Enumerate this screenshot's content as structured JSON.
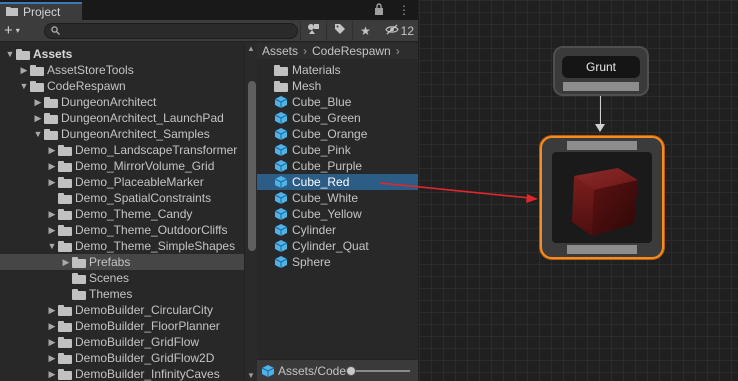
{
  "window": {
    "tab_title": "Project",
    "hidden_count": "12"
  },
  "toolbar": {
    "add_label": "+",
    "search_placeholder": ""
  },
  "tree": {
    "items": [
      {
        "label": "Assets",
        "depth": 0,
        "expanded": true,
        "bold": true
      },
      {
        "label": "AssetStoreTools",
        "depth": 1,
        "expanded": false
      },
      {
        "label": "CodeRespawn",
        "depth": 1,
        "expanded": true
      },
      {
        "label": "DungeonArchitect",
        "depth": 2,
        "expanded": false
      },
      {
        "label": "DungeonArchitect_LaunchPad",
        "depth": 2,
        "expanded": false
      },
      {
        "label": "DungeonArchitect_Samples",
        "depth": 2,
        "expanded": true
      },
      {
        "label": "Demo_LandscapeTransformer",
        "depth": 3,
        "expanded": false
      },
      {
        "label": "Demo_MirrorVolume_Grid",
        "depth": 3,
        "expanded": false
      },
      {
        "label": "Demo_PlaceableMarker",
        "depth": 3,
        "expanded": false
      },
      {
        "label": "Demo_SpatialConstraints",
        "depth": 3,
        "leaf": true
      },
      {
        "label": "Demo_Theme_Candy",
        "depth": 3,
        "expanded": false
      },
      {
        "label": "Demo_Theme_OutdoorCliffs",
        "depth": 3,
        "expanded": false
      },
      {
        "label": "Demo_Theme_SimpleShapes",
        "depth": 3,
        "expanded": true
      },
      {
        "label": "Prefabs",
        "depth": 4,
        "expanded": false,
        "selected": true
      },
      {
        "label": "Scenes",
        "depth": 4,
        "leaf": true
      },
      {
        "label": "Themes",
        "depth": 4,
        "leaf": true
      },
      {
        "label": "DemoBuilder_CircularCity",
        "depth": 3,
        "expanded": false
      },
      {
        "label": "DemoBuilder_FloorPlanner",
        "depth": 3,
        "expanded": false
      },
      {
        "label": "DemoBuilder_GridFlow",
        "depth": 3,
        "expanded": false
      },
      {
        "label": "DemoBuilder_GridFlow2D",
        "depth": 3,
        "expanded": false
      },
      {
        "label": "DemoBuilder_InfinityCaves",
        "depth": 3,
        "expanded": false
      }
    ]
  },
  "assets": {
    "breadcrumb": [
      "Assets",
      "CodeRespawn"
    ],
    "items": [
      {
        "label": "Materials",
        "kind": "folder"
      },
      {
        "label": "Mesh",
        "kind": "folder"
      },
      {
        "label": "Cube_Blue",
        "kind": "prefab"
      },
      {
        "label": "Cube_Green",
        "kind": "prefab"
      },
      {
        "label": "Cube_Orange",
        "kind": "prefab"
      },
      {
        "label": "Cube_Pink",
        "kind": "prefab"
      },
      {
        "label": "Cube_Purple",
        "kind": "prefab"
      },
      {
        "label": "Cube_Red",
        "kind": "prefab",
        "selected": true
      },
      {
        "label": "Cube_White",
        "kind": "prefab"
      },
      {
        "label": "Cube_Yellow",
        "kind": "prefab"
      },
      {
        "label": "Cylinder",
        "kind": "prefab"
      },
      {
        "label": "Cylinder_Quat",
        "kind": "prefab"
      },
      {
        "label": "Sphere",
        "kind": "prefab"
      }
    ],
    "status_path": "Assets/Code"
  },
  "graph": {
    "source_node_label": "Grunt",
    "colors": {
      "selected_outline": "#f68b1f",
      "annotation_arrow": "#e0262b",
      "cube_face": "#7a1a1a"
    }
  }
}
